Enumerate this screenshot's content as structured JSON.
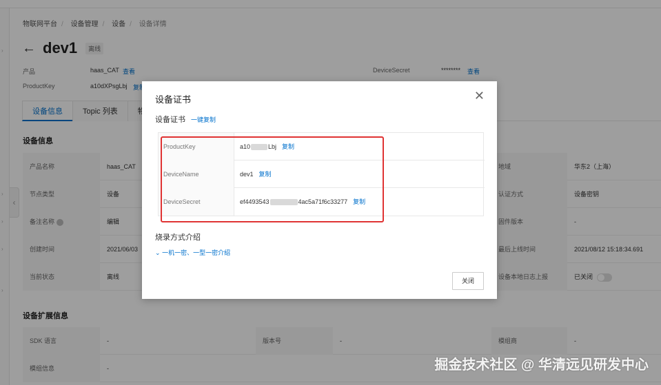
{
  "breadcrumb": [
    "物联网平台",
    "设备管理",
    "设备",
    "设备详情"
  ],
  "header": {
    "title": "dev1",
    "status": "离线"
  },
  "meta": {
    "product_label": "产品",
    "product_value": "haas_CAT",
    "product_link": "查看",
    "productkey_label": "ProductKey",
    "productkey_value": "a10dXPsgLbj",
    "productkey_link": "复制",
    "devicesecret_label": "DeviceSecret",
    "devicesecret_value": "********",
    "devicesecret_link": "查看"
  },
  "tabs": [
    "设备信息",
    "Topic 列表",
    "物"
  ],
  "sections": {
    "device_info": "设备信息",
    "device_ext_info": "设备扩展信息"
  },
  "device_info_rows": [
    {
      "l1": "产品名称",
      "v1": "haas_CAT",
      "l3": "地域",
      "v3": "华东2（上海）"
    },
    {
      "l1": "节点类型",
      "v1": "设备",
      "l3": "认证方式",
      "v3": "设备密钥"
    },
    {
      "l1": "备注名称",
      "v1": "编辑",
      "l3": "固件版本",
      "v3": "-"
    },
    {
      "l1": "创建时间",
      "v1": "2021/06/03",
      "l3": "最后上线时间",
      "v3": "2021/08/12 15:18:34.691"
    },
    {
      "l1": "当前状态",
      "v1": "离线",
      "l3": "设备本地日志上报",
      "v3": "已关闭"
    }
  ],
  "ext_rows": [
    {
      "l1": "SDK 语言",
      "v1": "-",
      "l2": "版本号",
      "v2": "-",
      "l3": "模组商",
      "v3": "-"
    },
    {
      "l1": "模组信息",
      "v1": "-"
    }
  ],
  "modal": {
    "title": "设备证书",
    "cert_label": "设备证书",
    "copy_all": "一键复制",
    "rows": [
      {
        "key": "ProductKey",
        "value_start": "a10",
        "value_end": "Lbj",
        "copy": "复制"
      },
      {
        "key": "DeviceName",
        "value_start": "dev1",
        "value_end": "",
        "copy": "复制"
      },
      {
        "key": "DeviceSecret",
        "value_start": "ef4493543",
        "value_end": "4ac5a71f6c33277",
        "copy": "复制"
      }
    ],
    "burn_title": "烧录方式介绍",
    "burn_link": "一机一密、一型一密介绍",
    "close_button": "关闭"
  },
  "watermark": "掘金技术社区 @ 华清远见研发中心",
  "colors": {
    "accent": "#0070cc",
    "highlight": "#e03232"
  }
}
